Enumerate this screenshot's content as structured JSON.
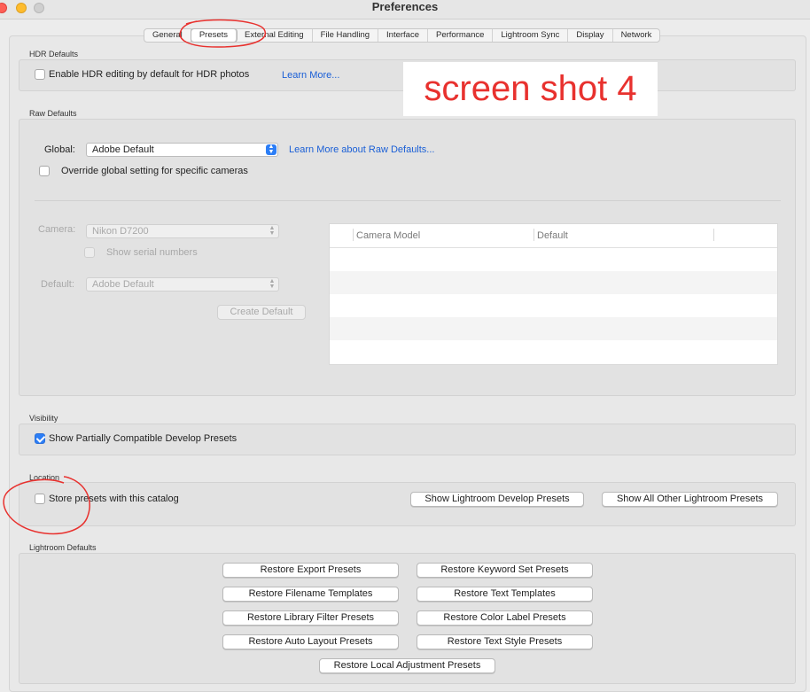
{
  "window": {
    "title": "Preferences"
  },
  "tabs": [
    {
      "label": "General",
      "active": false
    },
    {
      "label": "Presets",
      "active": true
    },
    {
      "label": "External Editing",
      "active": false
    },
    {
      "label": "File Handling",
      "active": false
    },
    {
      "label": "Interface",
      "active": false
    },
    {
      "label": "Performance",
      "active": false
    },
    {
      "label": "Lightroom Sync",
      "active": false
    },
    {
      "label": "Display",
      "active": false
    },
    {
      "label": "Network",
      "active": false
    }
  ],
  "overlay_label": "screen shot 4",
  "hdr_defaults": {
    "section_label": "HDR Defaults",
    "checkbox_label": "Enable HDR editing by default for HDR photos",
    "checked": false,
    "learn_more": "Learn More..."
  },
  "raw_defaults": {
    "section_label": "Raw Defaults",
    "global_label": "Global:",
    "global_value": "Adobe Default",
    "learn_more": "Learn More about Raw Defaults...",
    "override_label": "Override global setting for specific cameras",
    "override_checked": false,
    "camera_label": "Camera:",
    "camera_value": "Nikon D7200",
    "show_serial_label": "Show serial numbers",
    "default_label": "Default:",
    "default_value": "Adobe Default",
    "create_default_button": "Create Default",
    "table_headers": [
      "Camera Model",
      "Default"
    ]
  },
  "visibility": {
    "section_label": "Visibility",
    "checkbox_label": "Show Partially Compatible Develop Presets",
    "checked": true
  },
  "location": {
    "section_label": "Location",
    "checkbox_label": "Store presets with this catalog",
    "checked": false,
    "show_develop_button": "Show Lightroom Develop Presets",
    "show_other_button": "Show All Other Lightroom Presets"
  },
  "lightroom_defaults": {
    "section_label": "Lightroom Defaults",
    "buttons": [
      "Restore Export Presets",
      "Restore Keyword Set Presets",
      "Restore Filename Templates",
      "Restore Text Templates",
      "Restore Library Filter Presets",
      "Restore Color Label Presets",
      "Restore Auto Layout Presets",
      "Restore Text Style Presets",
      "Restore Local Adjustment Presets"
    ]
  },
  "colors": {
    "accent": "#2c7ef6",
    "link": "#1a5fd6",
    "annotation_red": "#e8312e"
  }
}
